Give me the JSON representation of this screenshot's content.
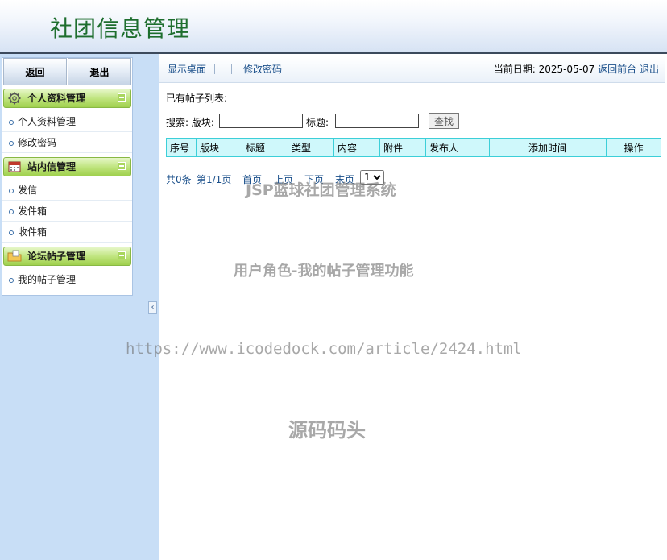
{
  "header": {
    "title": "社团信息管理"
  },
  "sidebar": {
    "buttons": {
      "back": "返回",
      "logout": "退出"
    },
    "groups": [
      {
        "title": "个人资料管理",
        "icon": "gear-icon",
        "items": [
          "个人资料管理",
          "修改密码"
        ]
      },
      {
        "title": "站内信管理",
        "icon": "calendar-icon",
        "items": [
          "发信",
          "发件箱",
          "收件箱"
        ]
      },
      {
        "title": "论坛帖子管理",
        "icon": "folder-icon",
        "items": [
          "我的帖子管理"
        ]
      }
    ]
  },
  "toolbar": {
    "show_desktop": "显示桌面",
    "change_password": "修改密码",
    "date_label": "当前日期:",
    "date_value": "2025-05-07",
    "back_front": "返回前台",
    "logout": "退出"
  },
  "content": {
    "list_title": "已有帖子列表:",
    "search": {
      "label": "搜索: 版块:",
      "title_label": "标题:",
      "board_value": "",
      "title_value": "",
      "button": "查找"
    },
    "table": {
      "columns": [
        "序号",
        "版块",
        "标题",
        "类型",
        "内容",
        "附件",
        "发布人",
        "添加时间",
        "操作"
      ],
      "rows": []
    },
    "pager": {
      "total": "共0条",
      "page": "第1/1页",
      "first": "首页",
      "prev": "上页",
      "next": "下页",
      "last": "末页",
      "selected": "1"
    }
  },
  "watermarks": {
    "line1": "JSP篮球社团管理系统",
    "line2": "用户角色-我的帖子管理功能",
    "line3": "https://www.icodedock.com/article/2424.html",
    "line4": "源码码头"
  },
  "colors": {
    "title_green": "#1e6e2e",
    "sidebar_bg": "#c8def6",
    "group_header_green": "#bde37a",
    "table_header_bg": "#cff8fb",
    "table_border": "#3ccfd8",
    "link_blue": "#1a4f8a"
  }
}
